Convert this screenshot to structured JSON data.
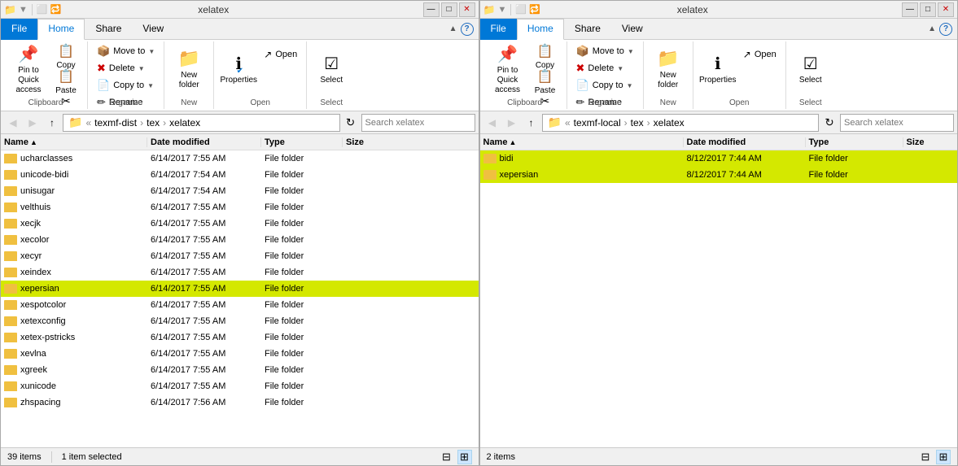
{
  "windows": [
    {
      "id": "left",
      "title": "xelatex",
      "tabs": [
        "File",
        "Home",
        "Share",
        "View"
      ],
      "active_tab": "Home",
      "path": [
        "texmf-dist",
        "tex",
        "xelatex"
      ],
      "search_placeholder": "Search xelatex",
      "ribbon": {
        "groups": [
          {
            "label": "Clipboard",
            "large_buttons": [
              {
                "id": "pin",
                "icon": "📌",
                "label": "Pin to Quick\naccess"
              },
              {
                "id": "copy",
                "icon": "📋",
                "label": "Copy"
              },
              {
                "id": "paste",
                "icon": "📋",
                "label": "Paste"
              }
            ],
            "small_buttons": []
          },
          {
            "label": "Organize",
            "large_buttons": [],
            "small_buttons": [
              {
                "id": "moveto",
                "icon": "→",
                "label": "Move to",
                "dropdown": true
              },
              {
                "id": "delete",
                "icon": "✖",
                "label": "Delete",
                "dropdown": true
              },
              {
                "id": "copyto",
                "icon": "→",
                "label": "Copy to",
                "dropdown": true
              },
              {
                "id": "rename",
                "icon": "✏",
                "label": "Rename"
              }
            ]
          },
          {
            "label": "New",
            "large_buttons": [
              {
                "id": "newfolder",
                "icon": "📁",
                "label": "New\nfolder"
              }
            ],
            "small_buttons": []
          },
          {
            "label": "Open",
            "large_buttons": [
              {
                "id": "properties",
                "icon": "ℹ",
                "label": "Properties"
              }
            ],
            "small_buttons": [
              {
                "id": "open",
                "icon": "↗",
                "label": "Open"
              }
            ]
          },
          {
            "label": "Select",
            "large_buttons": [
              {
                "id": "select",
                "icon": "☑",
                "label": "Select"
              }
            ],
            "small_buttons": []
          }
        ]
      },
      "columns": [
        "Name",
        "Date modified",
        "Type",
        "Size"
      ],
      "files": [
        {
          "name": "ucharclasses",
          "date": "6/14/2017 7:55 AM",
          "type": "File folder",
          "selected": false,
          "highlighted": false
        },
        {
          "name": "unicode-bidi",
          "date": "6/14/2017 7:54 AM",
          "type": "File folder",
          "selected": false,
          "highlighted": false
        },
        {
          "name": "unisugar",
          "date": "6/14/2017 7:54 AM",
          "type": "File folder",
          "selected": false,
          "highlighted": false
        },
        {
          "name": "velthuis",
          "date": "6/14/2017 7:55 AM",
          "type": "File folder",
          "selected": false,
          "highlighted": false
        },
        {
          "name": "xecjk",
          "date": "6/14/2017 7:55 AM",
          "type": "File folder",
          "selected": false,
          "highlighted": false
        },
        {
          "name": "xecolor",
          "date": "6/14/2017 7:55 AM",
          "type": "File folder",
          "selected": false,
          "highlighted": false
        },
        {
          "name": "xecyr",
          "date": "6/14/2017 7:55 AM",
          "type": "File folder",
          "selected": false,
          "highlighted": false
        },
        {
          "name": "xeindex",
          "date": "6/14/2017 7:55 AM",
          "type": "File folder",
          "selected": false,
          "highlighted": false
        },
        {
          "name": "xepersian",
          "date": "6/14/2017 7:55 AM",
          "type": "File folder",
          "selected": true,
          "highlighted": true
        },
        {
          "name": "xespotcolor",
          "date": "6/14/2017 7:55 AM",
          "type": "File folder",
          "selected": false,
          "highlighted": false
        },
        {
          "name": "xetexconfig",
          "date": "6/14/2017 7:55 AM",
          "type": "File folder",
          "selected": false,
          "highlighted": false
        },
        {
          "name": "xetex-pstricks",
          "date": "6/14/2017 7:55 AM",
          "type": "File folder",
          "selected": false,
          "highlighted": false
        },
        {
          "name": "xevlna",
          "date": "6/14/2017 7:55 AM",
          "type": "File folder",
          "selected": false,
          "highlighted": false
        },
        {
          "name": "xgreek",
          "date": "6/14/2017 7:55 AM",
          "type": "File folder",
          "selected": false,
          "highlighted": false
        },
        {
          "name": "xunicode",
          "date": "6/14/2017 7:55 AM",
          "type": "File folder",
          "selected": false,
          "highlighted": false
        },
        {
          "name": "zhspacing",
          "date": "6/14/2017 7:56 AM",
          "type": "File folder",
          "selected": false,
          "highlighted": false
        }
      ],
      "status": "39 items",
      "status2": "1 item selected"
    },
    {
      "id": "right",
      "title": "xelatex",
      "tabs": [
        "File",
        "Home",
        "Share",
        "View"
      ],
      "active_tab": "Home",
      "path": [
        "texmf-local",
        "tex",
        "xelatex"
      ],
      "search_placeholder": "Search xelatex",
      "ribbon": {
        "groups": [
          {
            "label": "Clipboard",
            "large_buttons": [
              {
                "id": "pin",
                "icon": "📌",
                "label": "Pin to Quick\naccess"
              },
              {
                "id": "copy",
                "icon": "📋",
                "label": "Copy"
              },
              {
                "id": "paste",
                "icon": "📋",
                "label": "Paste"
              }
            ]
          },
          {
            "label": "Organize",
            "small_buttons": [
              {
                "id": "moveto",
                "icon": "→",
                "label": "Move to",
                "dropdown": true
              },
              {
                "id": "delete",
                "icon": "✖",
                "label": "Delete",
                "dropdown": true
              },
              {
                "id": "copyto",
                "icon": "→",
                "label": "Copy to",
                "dropdown": true
              },
              {
                "id": "rename",
                "icon": "✏",
                "label": "Rename"
              }
            ]
          },
          {
            "label": "New",
            "large_buttons": [
              {
                "id": "newfolder",
                "icon": "📁",
                "label": "New\nfolder"
              }
            ]
          },
          {
            "label": "Open",
            "large_buttons": [
              {
                "id": "properties",
                "icon": "ℹ",
                "label": "Properties"
              }
            ],
            "small_buttons": [
              {
                "id": "open",
                "icon": "↗",
                "label": "Open"
              }
            ]
          },
          {
            "label": "Select",
            "large_buttons": [
              {
                "id": "select",
                "icon": "☑",
                "label": "Select"
              }
            ]
          }
        ]
      },
      "columns": [
        "Name",
        "Date modified",
        "Type",
        "Size"
      ],
      "files": [
        {
          "name": "bidi",
          "date": "8/12/2017 7:44 AM",
          "type": "File folder",
          "selected": true,
          "highlighted": true
        },
        {
          "name": "xepersian",
          "date": "8/12/2017 7:44 AM",
          "type": "File folder",
          "selected": false,
          "highlighted": true
        }
      ],
      "status": "2 items",
      "status2": ""
    }
  ]
}
